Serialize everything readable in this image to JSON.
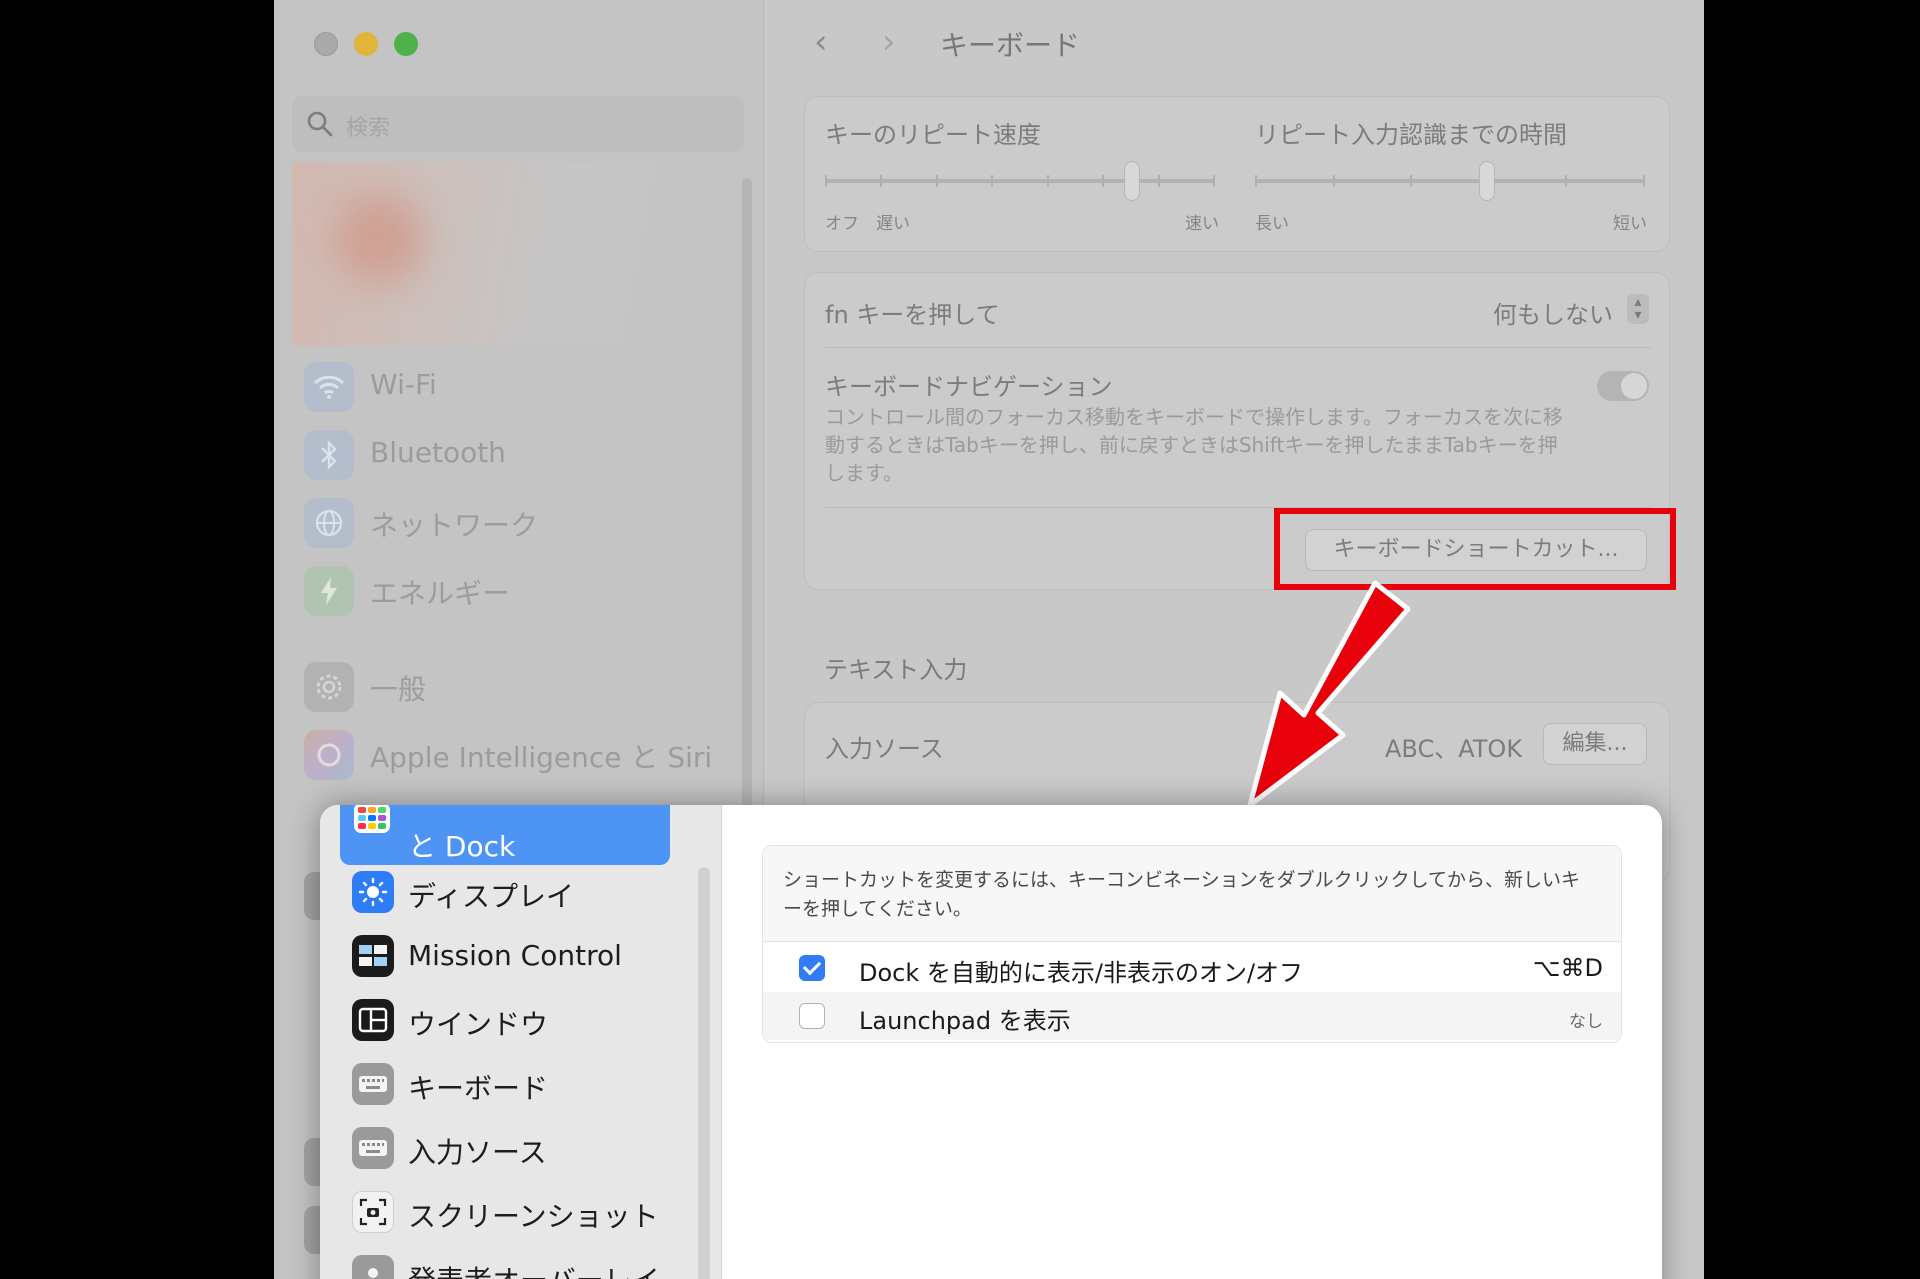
{
  "window": {
    "title": "キーボード",
    "search_placeholder": "検索",
    "sidebar": [
      {
        "label": "Wi-Fi",
        "icon": "wifi-icon"
      },
      {
        "label": "Bluetooth",
        "icon": "bluetooth-icon"
      },
      {
        "label": "ネットワーク",
        "icon": "globe-icon"
      },
      {
        "label": "エネルギー",
        "icon": "bolt-icon"
      },
      {
        "label": "一般",
        "icon": "gear-icon"
      },
      {
        "label": "Apple Intelligence と Siri",
        "icon": "siri-icon"
      }
    ],
    "repeat": {
      "label": "キーのリピート速度",
      "min_labels": "オフ　遅い",
      "max_label": "速い",
      "level": 0.8
    },
    "delay": {
      "label": "リピート入力認識までの時間",
      "min_label": "長い",
      "max_label": "短い",
      "level": 0.6
    },
    "fn_key": {
      "label": "fn キーを押して",
      "value": "何もしない"
    },
    "keyboard_nav": {
      "label": "キーボードナビゲーション",
      "description": "コントロール間のフォーカス移動をキーボードで操作します。フォーカスを次に移動するときはTabキーを押し、前に戻すときはShiftキーを押したままTabキーを押します。",
      "enabled": false
    },
    "shortcuts_button": "キーボードショートカット...",
    "text_input": {
      "heading": "テキスト入力",
      "input_sources_label": "入力ソース",
      "input_sources_value": "ABC、ATOK",
      "edit_button": "編集..."
    }
  },
  "sheet": {
    "sidebar": [
      {
        "label": "と Dock",
        "selected": true,
        "icon": "desktop-dock-icon"
      },
      {
        "label": "ディスプレイ",
        "icon": "display-icon"
      },
      {
        "label": "Mission Control",
        "icon": "mission-control-icon"
      },
      {
        "label": "ウインドウ",
        "icon": "windows-icon"
      },
      {
        "label": "キーボード",
        "icon": "keyboard-icon"
      },
      {
        "label": "入力ソース",
        "icon": "input-sources-icon"
      },
      {
        "label": "スクリーンショット",
        "icon": "screenshot-icon"
      },
      {
        "label": "発表者オーバーレイ",
        "icon": "presenter-overlay-icon"
      }
    ],
    "instructions": "ショートカットを変更するには、キーコンビネーションをダブルクリックしてから、新しいキーを押してください。",
    "shortcuts": [
      {
        "name": "Dock を自動的に表示/非表示のオン/オフ",
        "keys": "⌥⌘D",
        "enabled": true
      },
      {
        "name": "Launchpad を表示",
        "keys": "なし",
        "enabled": false
      }
    ]
  },
  "colors": {
    "annotation_red": "#e8000b",
    "accent_blue": "#2f7cf6",
    "selection_blue": "#4e94f5"
  }
}
